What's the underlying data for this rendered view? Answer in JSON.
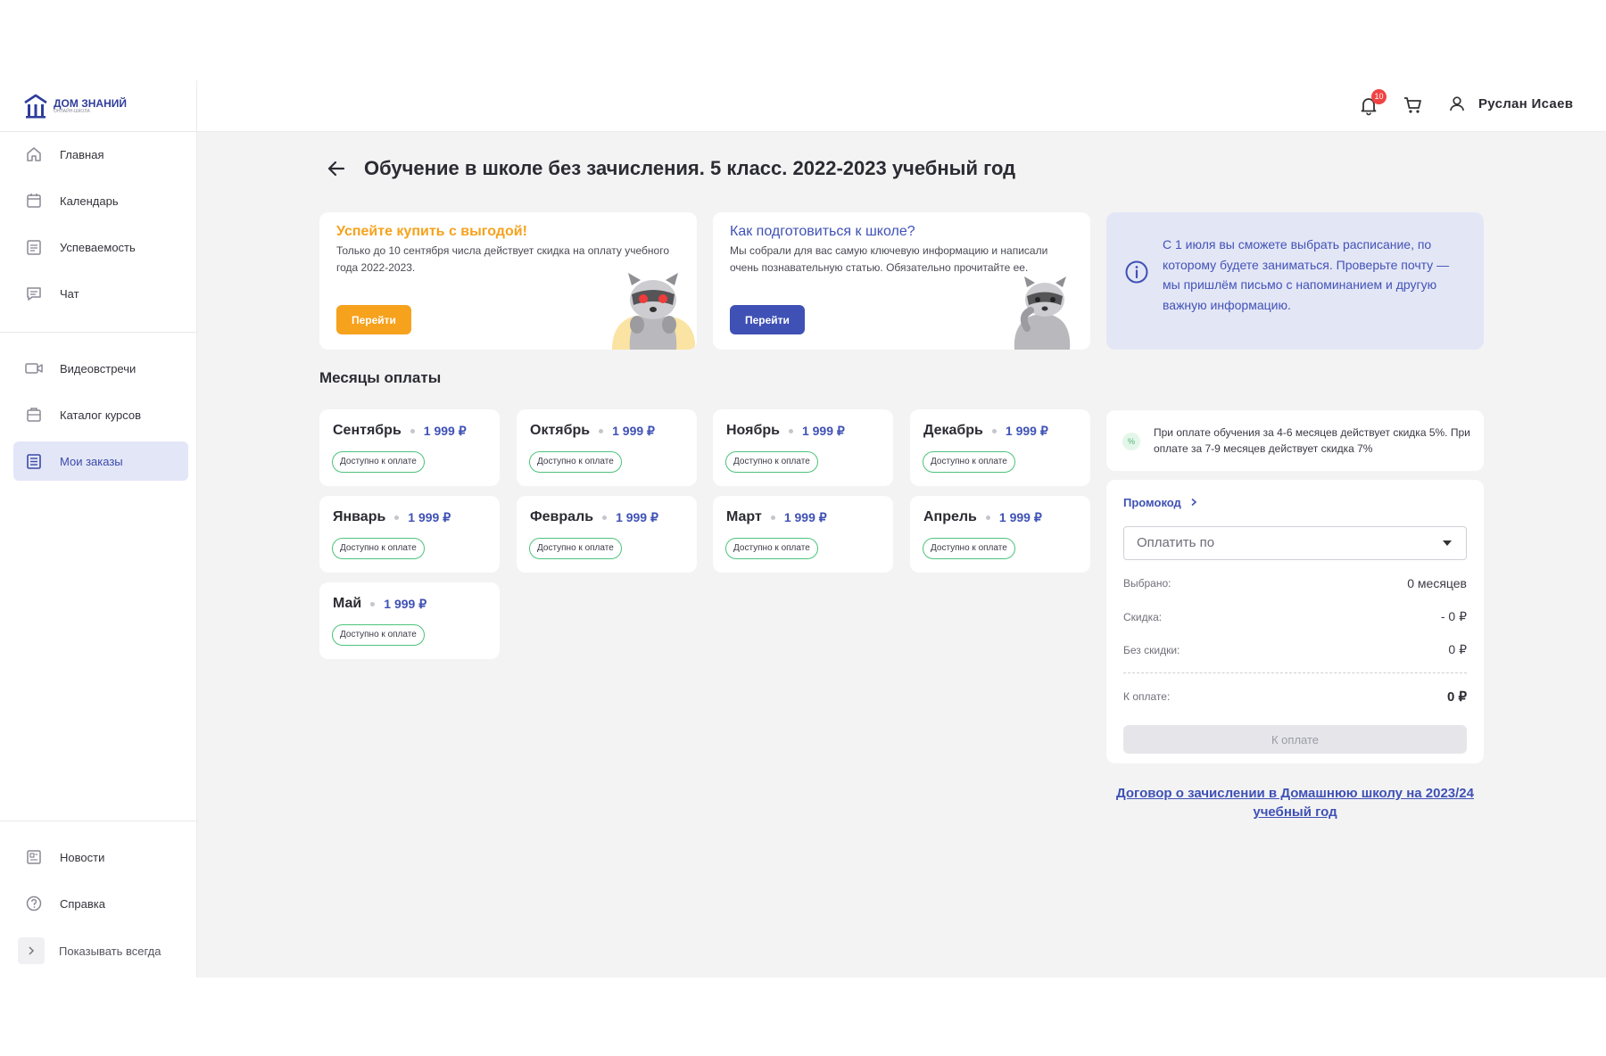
{
  "app": {
    "logo_title": "ДОМ ЗНАНИЙ",
    "logo_subtitle": "ОНЛАЙН-ШКОЛА"
  },
  "sidebar": {
    "items": [
      {
        "label": "Главная",
        "icon": "home-icon"
      },
      {
        "label": "Календарь",
        "icon": "calendar-icon"
      },
      {
        "label": "Успеваемость",
        "icon": "grades-icon"
      },
      {
        "label": "Чат",
        "icon": "chat-icon"
      },
      {
        "label": "Видеовстречи",
        "icon": "video-icon"
      },
      {
        "label": "Каталог курсов",
        "icon": "catalog-icon"
      },
      {
        "label": "Мои заказы",
        "icon": "orders-icon",
        "active": true
      }
    ],
    "bottom": [
      {
        "label": "Новости",
        "icon": "news-icon"
      },
      {
        "label": "Справка",
        "icon": "help-icon"
      }
    ],
    "show_always": "Показывать всегда"
  },
  "header": {
    "notifications_count": "10",
    "user_name": "Руслан Исаев"
  },
  "page": {
    "title": "Обучение в школе без зачисления. 5 класс. 2022-2023 учебный год"
  },
  "promos": [
    {
      "title": "Успейте купить с выгодой!",
      "text": "Только до 10 сентября числа действует скидка на оплату учебного года 2022-2023.",
      "button": "Перейти",
      "accent": "#f6a21d"
    },
    {
      "title": "Как подготовиться к школе?",
      "text": "Мы собрали для вас самую ключевую информацию и написали очень познавательную статью. Обязательно прочитайте ее.",
      "button": "Перейти",
      "accent": "#3f51b5"
    }
  ],
  "info": {
    "text": "С 1 июля вы сможете выбрать расписание, по которому будете заниматься. Проверьте почту — мы пришлём письмо с напоминанием и другую важную информацию."
  },
  "months": {
    "title": "Месяцы оплаты",
    "items": [
      {
        "name": "Сентябрь",
        "price": "1 999 ₽",
        "status": "Доступно к оплате"
      },
      {
        "name": "Октябрь",
        "price": "1 999 ₽",
        "status": "Доступно к оплате"
      },
      {
        "name": "Ноябрь",
        "price": "1 999 ₽",
        "status": "Доступно к оплате"
      },
      {
        "name": "Декабрь",
        "price": "1 999 ₽",
        "status": "Доступно к оплате"
      },
      {
        "name": "Январь",
        "price": "1 999 ₽",
        "status": "Доступно к оплате"
      },
      {
        "name": "Февраль",
        "price": "1 999 ₽",
        "status": "Доступно к оплате"
      },
      {
        "name": "Март",
        "price": "1 999 ₽",
        "status": "Доступно к оплате"
      },
      {
        "name": "Апрель",
        "price": "1 999 ₽",
        "status": "Доступно к оплате"
      },
      {
        "name": "Май",
        "price": "1 999 ₽",
        "status": "Доступно к оплате"
      }
    ]
  },
  "discount": {
    "badge": "%",
    "text": "При оплате обучения за 4-6 месяцев действует скидка 5%. При оплате за 7-9 месяцев действует скидка 7%"
  },
  "payment": {
    "promo_link": "Промокод",
    "select_placeholder": "Оплатить по",
    "selected_label": "Выбрано:",
    "selected_value": "0 месяцев",
    "discount_label": "Скидка:",
    "discount_value": "- 0 ₽",
    "no_discount_label": "Без скидки:",
    "no_discount_value": "0 ₽",
    "total_label": "К оплате:",
    "total_value": "0 ₽",
    "pay_button": "К оплате"
  },
  "contract_link": "Договор о зачислении в Домашнюю школу на 2023/24 учебный год",
  "colors": {
    "brand": "#3f51b5",
    "accent_orange": "#f6a21d",
    "badge_red": "#f04343",
    "status_green": "#4cc37a"
  }
}
